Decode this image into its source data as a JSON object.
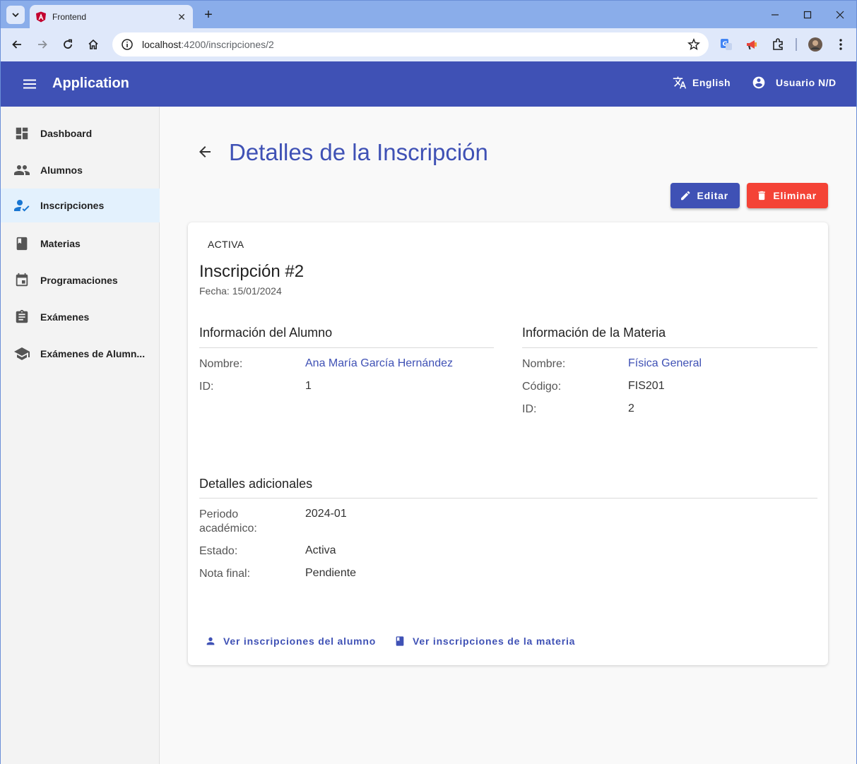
{
  "browser": {
    "tab_title": "Frontend",
    "url_host": "localhost",
    "url_rest": ":4200/inscripciones/2"
  },
  "header": {
    "app_title": "Application",
    "language_label": "English",
    "user_label": "Usuario N/D"
  },
  "sidebar": {
    "items": [
      {
        "label": "Dashboard",
        "icon": "dashboard-icon"
      },
      {
        "label": "Alumnos",
        "icon": "people-icon"
      },
      {
        "label": "Inscripciones",
        "icon": "how-to-reg-icon"
      },
      {
        "label": "Materias",
        "icon": "book-icon"
      },
      {
        "label": "Programaciones",
        "icon": "event-icon"
      },
      {
        "label": "Exámenes",
        "icon": "assignment-icon"
      },
      {
        "label": "Exámenes de Alumn...",
        "icon": "school-icon"
      }
    ],
    "active_index": 2
  },
  "page": {
    "title": "Detalles de la Inscripción",
    "edit_label": "Editar",
    "delete_label": "Eliminar"
  },
  "card": {
    "status": "ACTIVA",
    "title": "Inscripción #2",
    "subtitle": "Fecha: 15/01/2024",
    "student": {
      "section_title": "Información del Alumno",
      "name_label": "Nombre:",
      "name_value": "Ana María García Hernández",
      "id_label": "ID:",
      "id_value": "1"
    },
    "subject": {
      "section_title": "Información de la Materia",
      "name_label": "Nombre:",
      "name_value": "Física General",
      "code_label": "Código:",
      "code_value": "FIS201",
      "id_label": "ID:",
      "id_value": "2"
    },
    "extra": {
      "section_title": "Detalles adicionales",
      "period_label": "Periodo académico:",
      "period_value": "2024-01",
      "state_label": "Estado:",
      "state_value": "Activa",
      "grade_label": "Nota final:",
      "grade_value": "Pendiente"
    },
    "actions": {
      "student_link": "Ver inscripciones del alumno",
      "subject_link": "Ver inscripciones de la materia"
    }
  },
  "colors": {
    "primary": "#3f51b5",
    "warn": "#f44336",
    "active_nav": "#e3f1fd"
  }
}
